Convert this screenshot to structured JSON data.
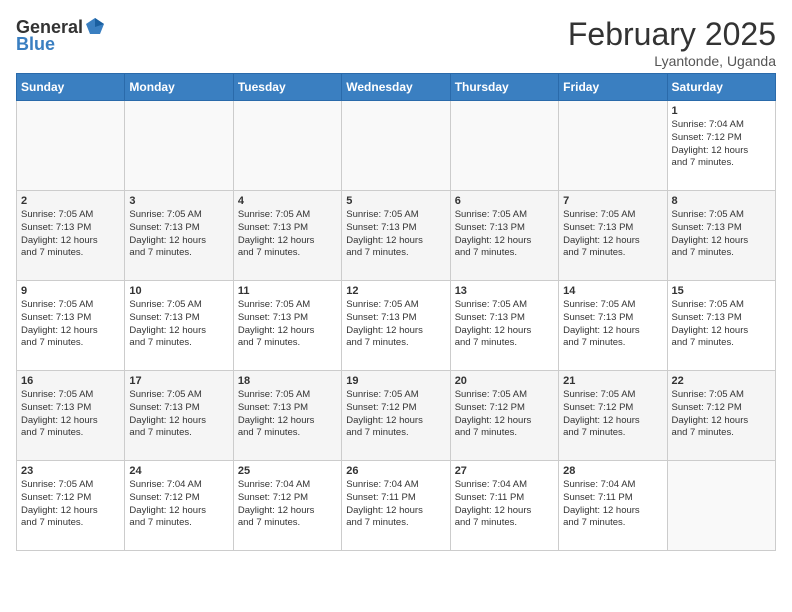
{
  "logo": {
    "general": "General",
    "blue": "Blue"
  },
  "title": "February 2025",
  "subtitle": "Lyantonde, Uganda",
  "weekdays": [
    "Sunday",
    "Monday",
    "Tuesday",
    "Wednesday",
    "Thursday",
    "Friday",
    "Saturday"
  ],
  "weeks": [
    [
      {
        "day": "",
        "info": ""
      },
      {
        "day": "",
        "info": ""
      },
      {
        "day": "",
        "info": ""
      },
      {
        "day": "",
        "info": ""
      },
      {
        "day": "",
        "info": ""
      },
      {
        "day": "",
        "info": ""
      },
      {
        "day": "1",
        "info": "Sunrise: 7:04 AM\nSunset: 7:12 PM\nDaylight: 12 hours\nand 7 minutes."
      }
    ],
    [
      {
        "day": "2",
        "info": "Sunrise: 7:05 AM\nSunset: 7:13 PM\nDaylight: 12 hours\nand 7 minutes."
      },
      {
        "day": "3",
        "info": "Sunrise: 7:05 AM\nSunset: 7:13 PM\nDaylight: 12 hours\nand 7 minutes."
      },
      {
        "day": "4",
        "info": "Sunrise: 7:05 AM\nSunset: 7:13 PM\nDaylight: 12 hours\nand 7 minutes."
      },
      {
        "day": "5",
        "info": "Sunrise: 7:05 AM\nSunset: 7:13 PM\nDaylight: 12 hours\nand 7 minutes."
      },
      {
        "day": "6",
        "info": "Sunrise: 7:05 AM\nSunset: 7:13 PM\nDaylight: 12 hours\nand 7 minutes."
      },
      {
        "day": "7",
        "info": "Sunrise: 7:05 AM\nSunset: 7:13 PM\nDaylight: 12 hours\nand 7 minutes."
      },
      {
        "day": "8",
        "info": "Sunrise: 7:05 AM\nSunset: 7:13 PM\nDaylight: 12 hours\nand 7 minutes."
      }
    ],
    [
      {
        "day": "9",
        "info": "Sunrise: 7:05 AM\nSunset: 7:13 PM\nDaylight: 12 hours\nand 7 minutes."
      },
      {
        "day": "10",
        "info": "Sunrise: 7:05 AM\nSunset: 7:13 PM\nDaylight: 12 hours\nand 7 minutes."
      },
      {
        "day": "11",
        "info": "Sunrise: 7:05 AM\nSunset: 7:13 PM\nDaylight: 12 hours\nand 7 minutes."
      },
      {
        "day": "12",
        "info": "Sunrise: 7:05 AM\nSunset: 7:13 PM\nDaylight: 12 hours\nand 7 minutes."
      },
      {
        "day": "13",
        "info": "Sunrise: 7:05 AM\nSunset: 7:13 PM\nDaylight: 12 hours\nand 7 minutes."
      },
      {
        "day": "14",
        "info": "Sunrise: 7:05 AM\nSunset: 7:13 PM\nDaylight: 12 hours\nand 7 minutes."
      },
      {
        "day": "15",
        "info": "Sunrise: 7:05 AM\nSunset: 7:13 PM\nDaylight: 12 hours\nand 7 minutes."
      }
    ],
    [
      {
        "day": "16",
        "info": "Sunrise: 7:05 AM\nSunset: 7:13 PM\nDaylight: 12 hours\nand 7 minutes."
      },
      {
        "day": "17",
        "info": "Sunrise: 7:05 AM\nSunset: 7:13 PM\nDaylight: 12 hours\nand 7 minutes."
      },
      {
        "day": "18",
        "info": "Sunrise: 7:05 AM\nSunset: 7:13 PM\nDaylight: 12 hours\nand 7 minutes."
      },
      {
        "day": "19",
        "info": "Sunrise: 7:05 AM\nSunset: 7:12 PM\nDaylight: 12 hours\nand 7 minutes."
      },
      {
        "day": "20",
        "info": "Sunrise: 7:05 AM\nSunset: 7:12 PM\nDaylight: 12 hours\nand 7 minutes."
      },
      {
        "day": "21",
        "info": "Sunrise: 7:05 AM\nSunset: 7:12 PM\nDaylight: 12 hours\nand 7 minutes."
      },
      {
        "day": "22",
        "info": "Sunrise: 7:05 AM\nSunset: 7:12 PM\nDaylight: 12 hours\nand 7 minutes."
      }
    ],
    [
      {
        "day": "23",
        "info": "Sunrise: 7:05 AM\nSunset: 7:12 PM\nDaylight: 12 hours\nand 7 minutes."
      },
      {
        "day": "24",
        "info": "Sunrise: 7:04 AM\nSunset: 7:12 PM\nDaylight: 12 hours\nand 7 minutes."
      },
      {
        "day": "25",
        "info": "Sunrise: 7:04 AM\nSunset: 7:12 PM\nDaylight: 12 hours\nand 7 minutes."
      },
      {
        "day": "26",
        "info": "Sunrise: 7:04 AM\nSunset: 7:11 PM\nDaylight: 12 hours\nand 7 minutes."
      },
      {
        "day": "27",
        "info": "Sunrise: 7:04 AM\nSunset: 7:11 PM\nDaylight: 12 hours\nand 7 minutes."
      },
      {
        "day": "28",
        "info": "Sunrise: 7:04 AM\nSunset: 7:11 PM\nDaylight: 12 hours\nand 7 minutes."
      },
      {
        "day": "",
        "info": ""
      }
    ]
  ]
}
